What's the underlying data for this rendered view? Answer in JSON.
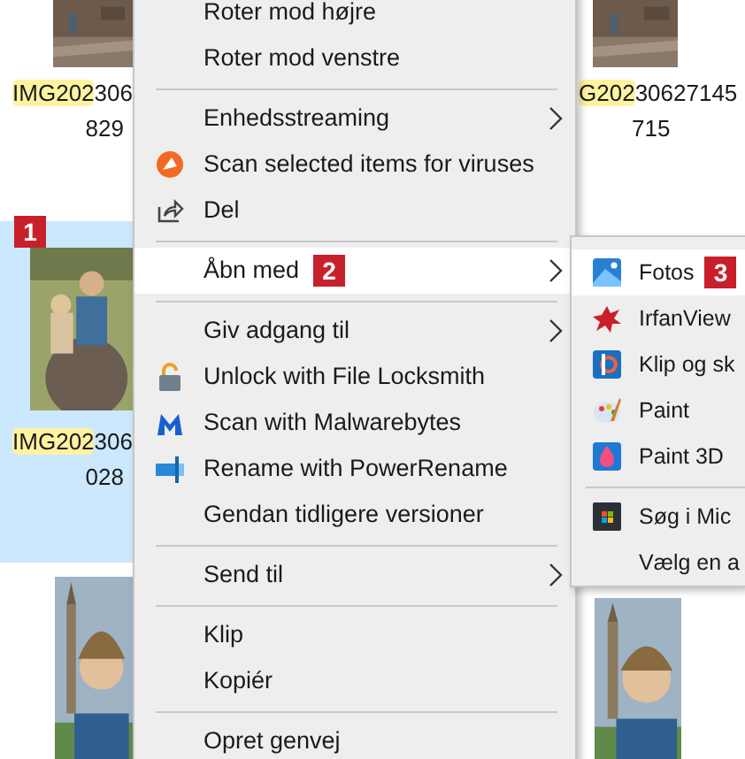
{
  "files": [
    {
      "selected": false,
      "name": {
        "match": "IMG202",
        "rest": "306",
        "line2": "829"
      }
    },
    {
      "selected": false,
      "name": {
        "match": "G202",
        "rest": "30627145",
        "line2": "715"
      }
    },
    {
      "selected": true,
      "marker": "1",
      "name": {
        "match": "IMG202",
        "rest": "306",
        "line2": "028"
      }
    },
    {
      "selected": false
    },
    {
      "selected": false
    }
  ],
  "context_menu": {
    "items": [
      {
        "kind": "item",
        "label": "Roter mod højre",
        "selected": false,
        "submenu": false
      },
      {
        "kind": "item",
        "label": "Roter mod venstre",
        "selected": false,
        "submenu": false
      },
      {
        "kind": "separator"
      },
      {
        "kind": "item",
        "label": "Enhedsstreaming",
        "selected": false,
        "submenu": true
      },
      {
        "kind": "item",
        "label": "Scan selected items for viruses",
        "selected": false,
        "submenu": false
      },
      {
        "kind": "item",
        "label": "Del",
        "selected": false,
        "submenu": false
      },
      {
        "kind": "separator"
      },
      {
        "kind": "item",
        "label": "Åbn med",
        "marker": "2",
        "selected": true,
        "submenu": true
      },
      {
        "kind": "separator"
      },
      {
        "kind": "item",
        "label": "Giv adgang til",
        "selected": false,
        "submenu": true
      },
      {
        "kind": "item",
        "label": "Unlock with File Locksmith",
        "selected": false,
        "submenu": false
      },
      {
        "kind": "item",
        "label": "Scan with Malwarebytes",
        "selected": false,
        "submenu": false
      },
      {
        "kind": "item",
        "label": "Rename with PowerRename",
        "selected": false,
        "submenu": false
      },
      {
        "kind": "item",
        "label": "Gendan tidligere versioner",
        "selected": false,
        "submenu": false
      },
      {
        "kind": "separator"
      },
      {
        "kind": "item",
        "label": "Send til",
        "selected": false,
        "submenu": true
      },
      {
        "kind": "separator"
      },
      {
        "kind": "item",
        "label": "Klip",
        "selected": false,
        "submenu": false
      },
      {
        "kind": "item",
        "label": "Kopiér",
        "selected": false,
        "submenu": false
      },
      {
        "kind": "separator"
      },
      {
        "kind": "item",
        "label": "Opret genvej",
        "selected": false,
        "submenu": false
      }
    ]
  },
  "open_with_menu": {
    "items": [
      {
        "kind": "item",
        "label": "Fotos",
        "marker": "3",
        "selected": true
      },
      {
        "kind": "item",
        "label": "IrfanView",
        "selected": false
      },
      {
        "kind": "item",
        "label": "Klip og sk",
        "selected": false
      },
      {
        "kind": "item",
        "label": "Paint",
        "selected": false
      },
      {
        "kind": "item",
        "label": "Paint 3D",
        "selected": false
      },
      {
        "kind": "separator"
      },
      {
        "kind": "item",
        "label": "Søg i Mic",
        "selected": false
      },
      {
        "kind": "item",
        "label": "Vælg en a",
        "selected": false
      }
    ]
  }
}
